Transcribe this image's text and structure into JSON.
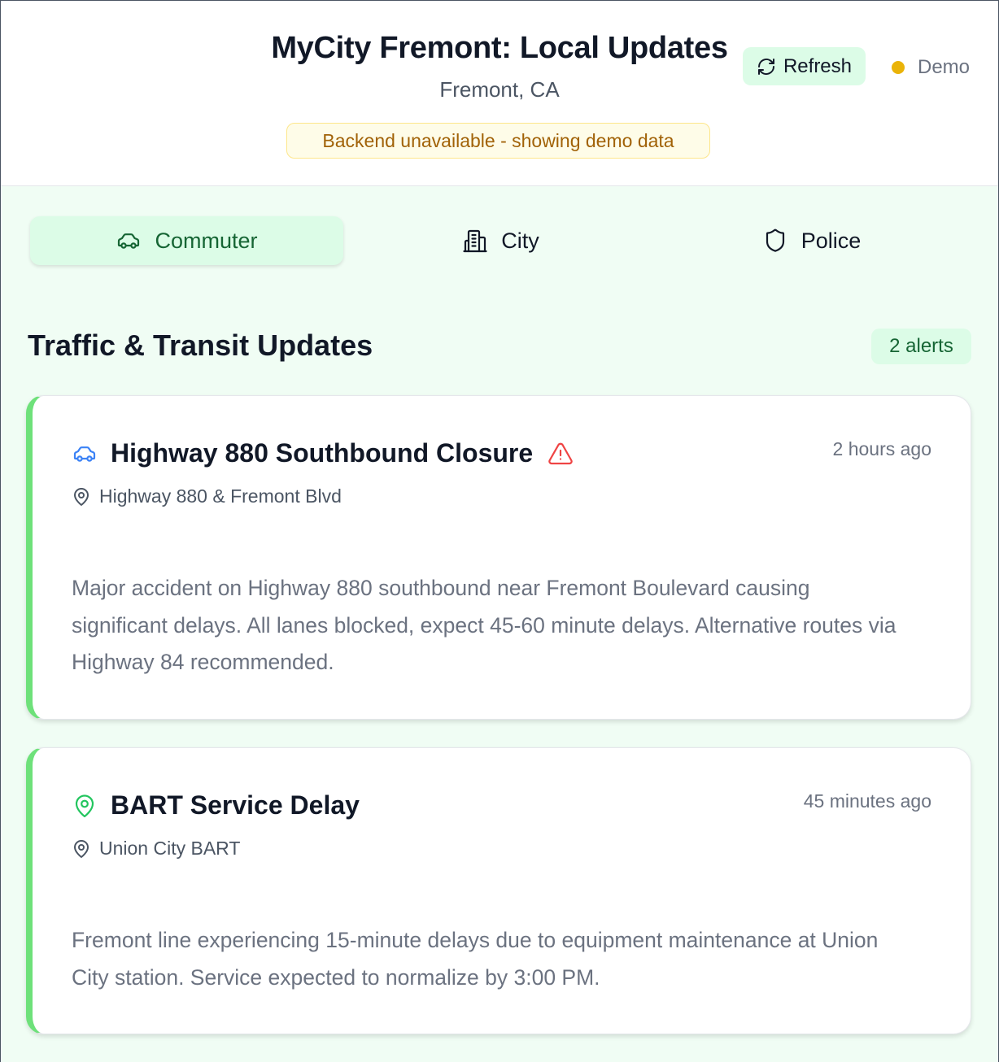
{
  "header": {
    "title": "MyCity Fremont: Local Updates",
    "location": "Fremont, CA",
    "banner": "Backend unavailable - showing demo data",
    "refresh_label": "Refresh",
    "status_label": "Demo",
    "status_color": "#eab308"
  },
  "tabs": [
    {
      "label": "Commuter",
      "icon": "car-icon",
      "active": true
    },
    {
      "label": "City",
      "icon": "building-icon",
      "active": false
    },
    {
      "label": "Police",
      "icon": "shield-icon",
      "active": false
    }
  ],
  "section": {
    "title": "Traffic & Transit Updates",
    "badge": "2 alerts"
  },
  "alerts": [
    {
      "title": "Highway 880 Southbound Closure",
      "type_icon": "car-icon",
      "type_icon_color": "#3b82f6",
      "warning_icon": "warning-triangle-icon",
      "time": "2 hours ago",
      "location": "Highway 880 & Fremont Blvd",
      "description": "Major accident on Highway 880 southbound near Fremont Boulevard causing significant delays. All lanes blocked, expect 45-60 minute delays. Alternative routes via Highway 84 recommended."
    },
    {
      "title": "BART Service Delay",
      "type_icon": "map-pin-icon",
      "type_icon_color": "#22c55e",
      "time": "45 minutes ago",
      "location": "Union City BART",
      "description": "Fremont line experiencing 15-minute delays due to equipment maintenance at Union City station. Service expected to normalize by 3:00 PM."
    }
  ],
  "colors": {
    "accent_green": "#dcfce7",
    "card_border": "#6ee17a",
    "banner_text": "#a16207",
    "warning_red": "#ef4444"
  }
}
